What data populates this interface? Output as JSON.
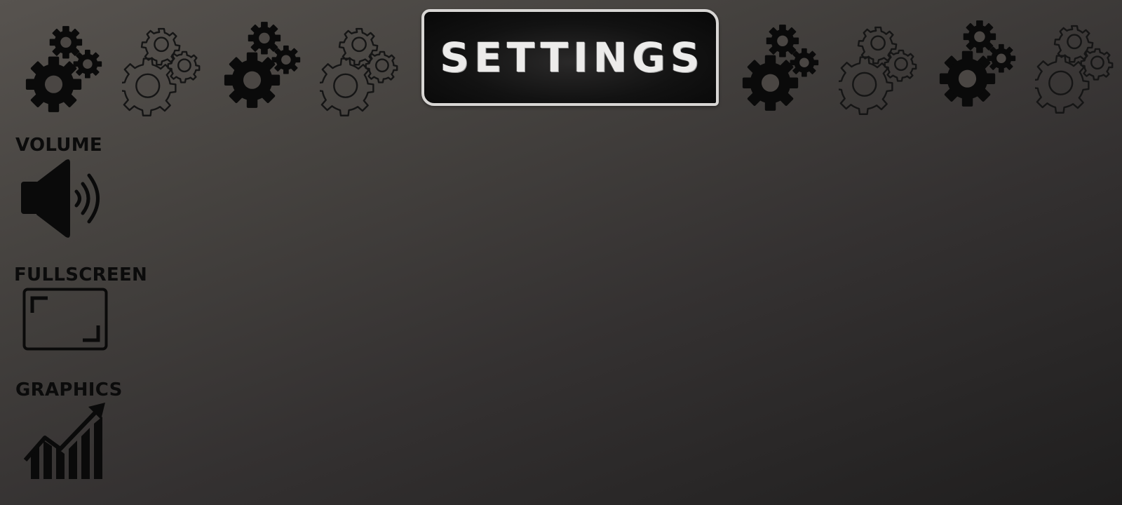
{
  "screen": {
    "title": "SETTINGS"
  },
  "settings": [
    {
      "label": "VOLUME",
      "icon": "speaker-volume-icon"
    },
    {
      "label": "FULLSCREEN",
      "icon": "fullscreen-frame-icon"
    },
    {
      "label": "GRAPHICS",
      "icon": "bar-chart-rising-icon"
    }
  ],
  "decor": {
    "icon": "gears-icon",
    "styles": [
      "solid",
      "outline",
      "solid",
      "outline",
      "solid",
      "outline",
      "solid",
      "outline"
    ]
  },
  "colors": {
    "background_top": "#57534f",
    "background_bottom": "#1f1e1e",
    "label_text": "#0b0b0b",
    "title_text": "#ecebea",
    "title_plate": "#0b0b0b",
    "title_border": "#d8d6d4"
  }
}
